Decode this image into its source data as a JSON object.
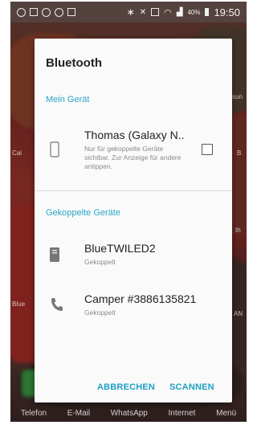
{
  "status_bar": {
    "battery": "40%",
    "time": "19:50"
  },
  "background": {
    "right_labels": [
      "sun",
      "B",
      "th",
      "AN"
    ],
    "left_labels": [
      "Cal",
      "Blue"
    ],
    "dock": [
      "Telefon",
      "E-Mail",
      "WhatsApp",
      "Internet",
      "Menü"
    ]
  },
  "dialog": {
    "title": "Bluetooth",
    "my_device_header": "Mein Gerät",
    "my_device": {
      "name": "Thomas (Galaxy N..",
      "description": "Nur für gekoppelte Geräte sichtbar. Zur Anzeige für andere antippen.",
      "visible_checked": false
    },
    "paired_header": "Gekoppelte Geräte",
    "paired_devices": [
      {
        "name": "BlueTWILED2",
        "status": "Gekoppelt",
        "icon": "device-icon"
      },
      {
        "name": "Camper #3886135821",
        "status": "Gekoppelt",
        "icon": "phone-icon"
      }
    ],
    "buttons": {
      "cancel": "ABBRECHEN",
      "scan": "SCANNEN"
    }
  },
  "colors": {
    "accent": "#2aa6c8",
    "button_text": "#1f9fc4"
  }
}
